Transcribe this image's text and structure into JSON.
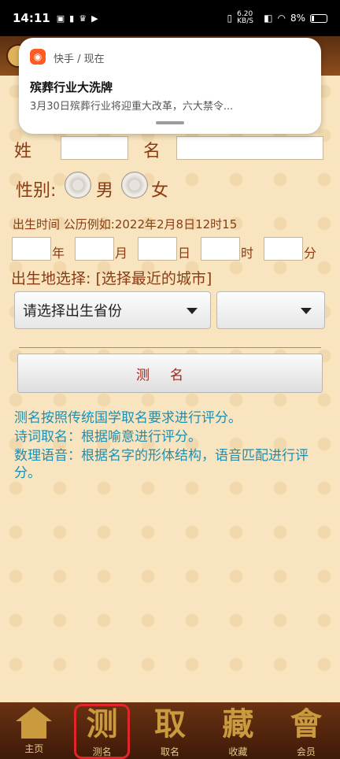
{
  "status_bar": {
    "time": "14:11",
    "network_speed": "6.20 KB/S",
    "battery": "8%"
  },
  "notification": {
    "app": "快手 / 现在",
    "title": "殡葬行业大洗牌",
    "body": "3月30日殡葬行业将迎重大改革，六大禁令..."
  },
  "form": {
    "surname_label": "姓",
    "name_label": "名",
    "gender_label": "性别:",
    "male": "男",
    "female": "女",
    "birth_time_label": "出生时间 公历例如:2022年2月8日12时15",
    "unit_year": "年",
    "unit_month": "月",
    "unit_day": "日",
    "unit_hour": "时",
    "unit_minute": "分",
    "birthplace_label": "出生地选择: [选择最近的城市]",
    "province_select": "请选择出生省份",
    "city_select": ""
  },
  "submit_button": "测名",
  "descriptions": [
    "测名按照传统国学取名要求进行评分。",
    "诗词取名：根据喻意进行评分。",
    "数理语音：根据名字的形体结构，语音匹配进行评分。"
  ],
  "tabs": [
    {
      "glyph": "",
      "label": "主页",
      "icon": "home-icon"
    },
    {
      "glyph": "测",
      "label": "测名"
    },
    {
      "glyph": "取",
      "label": "取名"
    },
    {
      "glyph": "藏",
      "label": "收藏"
    },
    {
      "glyph": "會",
      "label": "会员"
    }
  ],
  "colors": {
    "background": "#f8e4be",
    "label": "#8b3b12",
    "description": "#1d8fb2",
    "active_tab_outline": "#e0262a"
  }
}
